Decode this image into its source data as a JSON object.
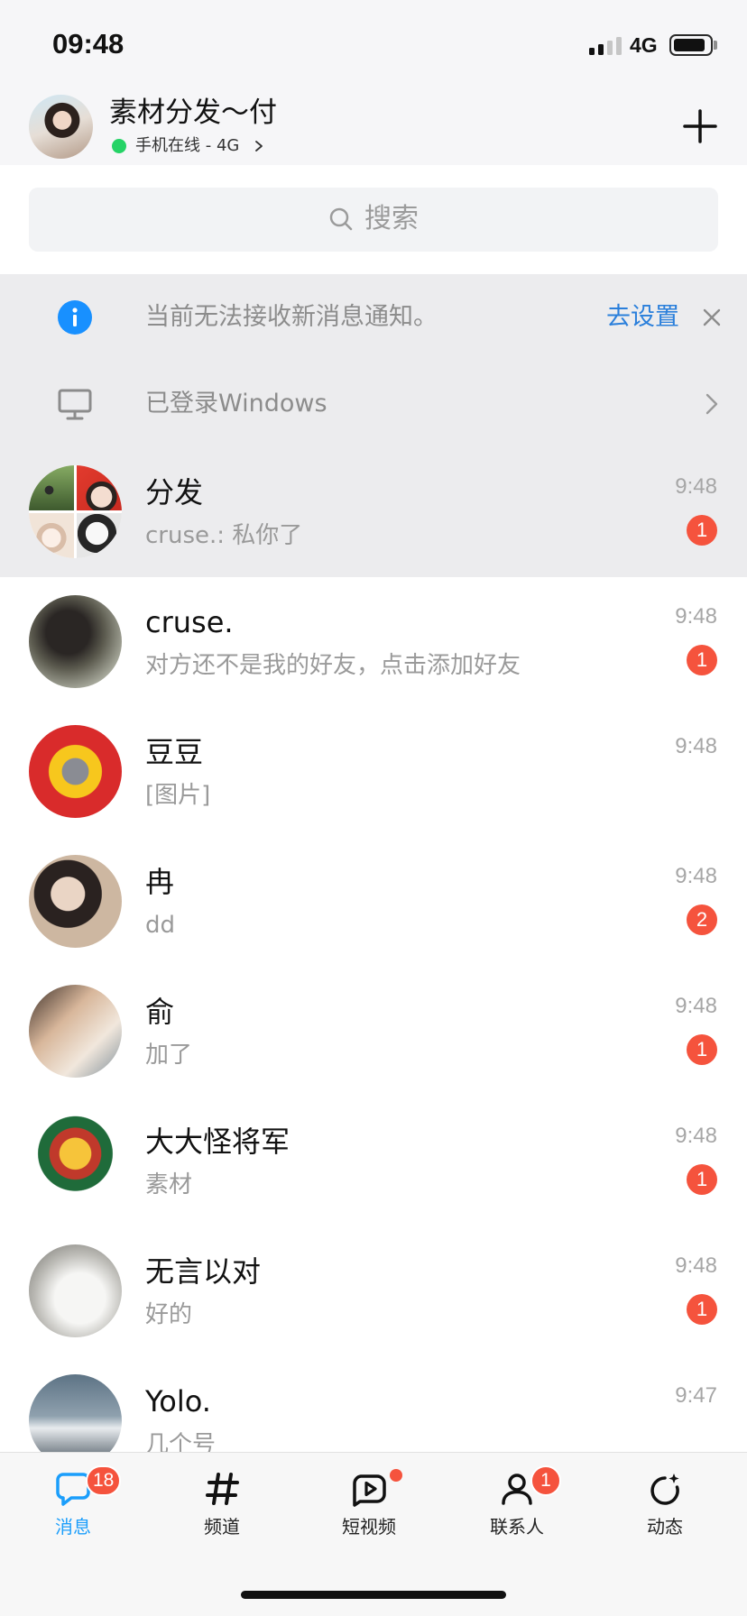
{
  "status_bar": {
    "time": "09:48",
    "network": "4G",
    "battery_level": 0.85,
    "signal_bars": 2
  },
  "header": {
    "name": "素材分发～付",
    "status": "手机在线 - 4G"
  },
  "search": {
    "placeholder": "搜索"
  },
  "notice": {
    "icon": "info-icon",
    "text": "当前无法接收新消息通知。",
    "action": "去设置"
  },
  "device": {
    "icon": "monitor-icon",
    "text": "已登录Windows"
  },
  "chats": [
    {
      "name": "分发",
      "preview": "cruse.: 私你了",
      "time": "9:48",
      "unread": "1"
    },
    {
      "name": "cruse.",
      "preview": "对方还不是我的好友，点击添加好友",
      "time": "9:48",
      "unread": "1"
    },
    {
      "name": "豆豆",
      "preview": "[图片]",
      "time": "9:48"
    },
    {
      "name": "冉",
      "preview": "dd",
      "time": "9:48",
      "unread": "2"
    },
    {
      "name": "俞",
      "preview": "加了",
      "time": "9:48",
      "unread": "1"
    },
    {
      "name": "大大怪将军",
      "preview": "素材",
      "time": "9:48",
      "unread": "1"
    },
    {
      "name": "无言以对",
      "preview": "好的",
      "time": "9:48",
      "unread": "1"
    },
    {
      "name": "Yolo.",
      "preview": "几个号",
      "time": "9:47"
    }
  ],
  "tabs": [
    {
      "label": "消息",
      "icon": "chat-bubble-icon",
      "badge": "18",
      "active": true
    },
    {
      "label": "频道",
      "icon": "hashtag-icon"
    },
    {
      "label": "短视频",
      "icon": "video-play-icon",
      "dot": true
    },
    {
      "label": "联系人",
      "icon": "contact-icon",
      "badge": "1"
    },
    {
      "label": "动态",
      "icon": "refresh-sparkle-icon"
    }
  ],
  "colors": {
    "accent": "#1b9efb",
    "badge": "#f5533d",
    "online": "#25d366",
    "link": "#2a7fdb",
    "info": "#1890ff"
  }
}
